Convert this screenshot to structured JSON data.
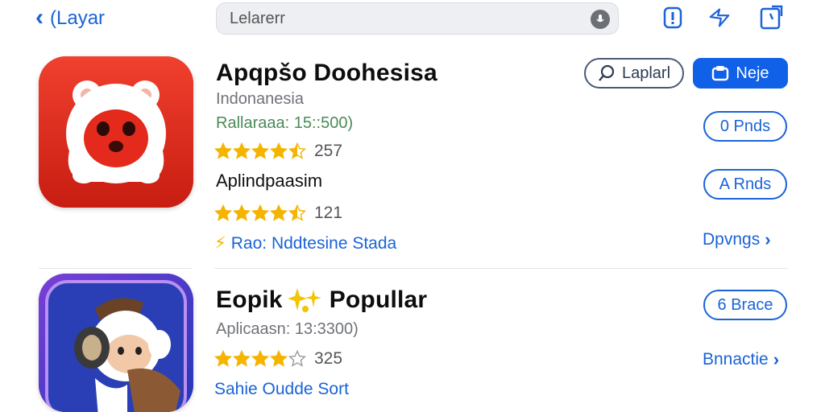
{
  "topbar": {
    "back_label": "(Layar",
    "search_value": "Lelarerr",
    "icons": [
      "chevron-left-icon",
      "mic-icon",
      "alert-icon",
      "share-icon",
      "bookmark-icon"
    ]
  },
  "apps": [
    {
      "title": "Apqpšo Doohesisa",
      "subtitle": "Indonanesia",
      "meta": "Rallaraaa: 15::500)",
      "rating_count": "257",
      "stars": 4.5,
      "section_label": "Aplindpaasim",
      "rating_count_2": "121",
      "stars_2": 4.5,
      "promo": "Rao: Nddtesine Stada",
      "buttons": {
        "outline": "Laplarl",
        "filled": "Neje",
        "secondary_1": "0 Pnds",
        "secondary_2": "A Rnds",
        "link": "Dpvngs"
      }
    },
    {
      "title": "Eopik",
      "title_suffix": "Popullar",
      "meta": "Aplicaasn: 13:3300)",
      "rating_count": "325",
      "stars": 4,
      "link_text": "Sahie Oudde Sort",
      "buttons": {
        "secondary": "6 Brace",
        "link": "Bnnactie"
      }
    }
  ],
  "colors": {
    "accent": "#1a63d8",
    "filled": "#1060e8",
    "star": "#f4b400",
    "icon1_bg": "#e32a1c",
    "icon2_bg": "#4d2fb3"
  }
}
